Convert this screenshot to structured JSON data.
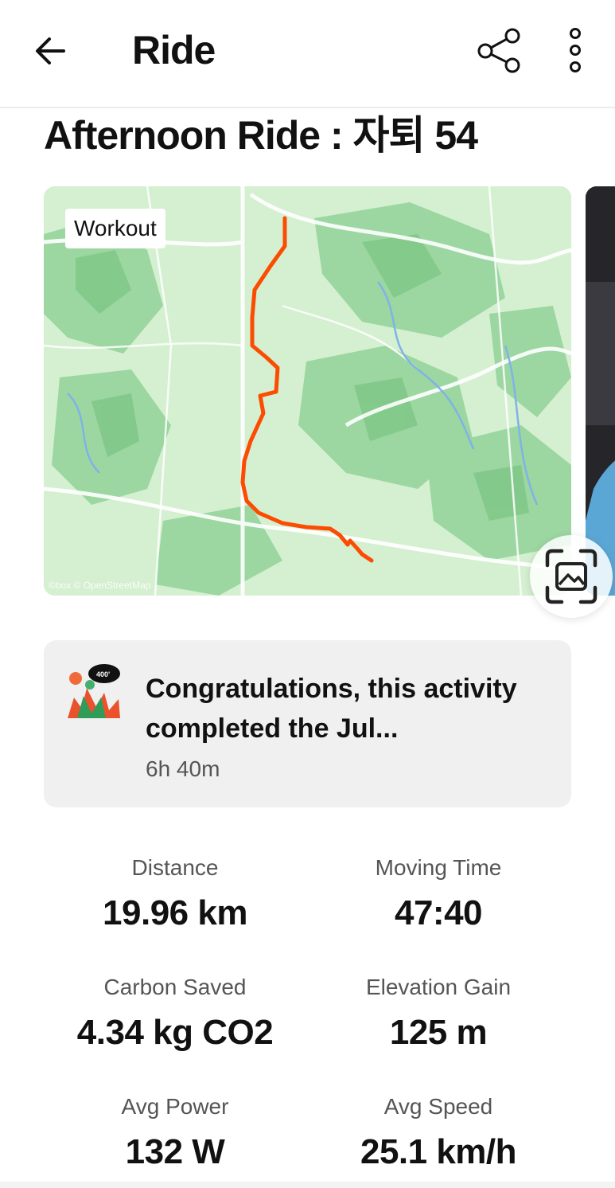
{
  "header": {
    "title": "Ride"
  },
  "activity": {
    "title": "Afternoon Ride : 자퇴 54"
  },
  "map": {
    "label": "Workout",
    "attribution": "©box © OpenStreetMap",
    "route_color": "#fc4c02",
    "land_color": "#cfeecb",
    "forest_color": "#8ccf93"
  },
  "challenge": {
    "text": "Congratulations, this activity completed the Jul...",
    "time": "6h 40m",
    "badge_text": "400'"
  },
  "stats": [
    {
      "label": "Distance",
      "value": "19.96 km"
    },
    {
      "label": "Moving Time",
      "value": "47:40"
    },
    {
      "label": "Carbon Saved",
      "value": "4.34 kg CO2"
    },
    {
      "label": "Elevation Gain",
      "value": "125 m"
    },
    {
      "label": "Avg Power",
      "value": "132 W"
    },
    {
      "label": "Avg Speed",
      "value": "25.1 km/h"
    }
  ]
}
